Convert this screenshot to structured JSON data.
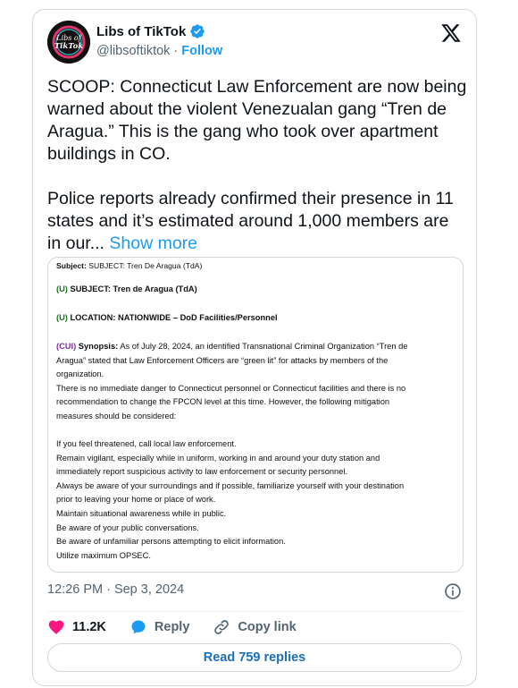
{
  "author": {
    "display_name": "Libs of TikTok",
    "handle": "@libsoftiktok",
    "separator": "·",
    "follow_label": "Follow",
    "avatar_text_line1": "Libs of",
    "avatar_text_line2": "TikTok"
  },
  "tweet": {
    "paragraph1": "SCOOP: Connecticut Law Enforcement are now being warned about the violent Venezualan gang “Tren de Aragua.” This is the gang who took over apartment buildings in CO.",
    "paragraph2": "Police reports already confirmed their presence in 11 states and it’s estimated around 1,000 members are in our... ",
    "show_more": "Show more"
  },
  "document": {
    "subject_header_label": "Subject:",
    "subject_header_value": "SUBJECT: Tren De Aragua (TdA)",
    "u_marker": "(U)",
    "subject_line": "SUBJECT: Tren de Aragua (TdA)",
    "location_line": "LOCATION: NATIONWIDE – DoD Facilities/Personnel",
    "cui_marker": "(CUI)",
    "synopsis_label": "Synopsis:",
    "synopsis_lines": [
      "As of July 28, 2024, an identified Transnational Criminal Organization “Tren de",
      "Aragua” stated that Law Enforcement Officers are “green lit” for attacks by members of the",
      "organization.",
      "There is no immediate danger to Connecticut personnel or Connecticut facilities and there is no",
      "recommendation to change the FPCON level at this time.  However, the following mitigation",
      "measures should be considered:"
    ],
    "measures": [
      "If you feel threatened, call local law enforcement.",
      "Remain vigilant, especially while in uniform, working in and around your duty station and",
      "immediately report suspicious activity to law enforcement or security personnel.",
      "Always be aware of your surroundings and if possible, familiarize yourself with your destination",
      "prior to leaving your home or place of work.",
      "Maintain situational awareness while in public.",
      "Be aware of your public conversations.",
      "Be aware of unfamiliar persons attempting to elicit information.",
      "Utilize maximum OPSEC."
    ]
  },
  "meta": {
    "timestamp": "12:26 PM · Sep 3, 2024"
  },
  "actions": {
    "likes": "11.2K",
    "reply": "Reply",
    "copy_link": "Copy link",
    "read_replies": "Read 759 replies"
  },
  "icons": {
    "verified": "verified-badge-icon",
    "x_logo": "x-logo-icon",
    "info": "info-icon",
    "heart": "heart-icon",
    "reply": "reply-bubble-icon",
    "link": "link-icon"
  },
  "colors": {
    "accent": "#1d9bf0",
    "heart": "#f91880",
    "reply_blue": "#1d9bf0",
    "u_green": "#1a7a1a",
    "cui_purple": "#7b2f9e"
  }
}
